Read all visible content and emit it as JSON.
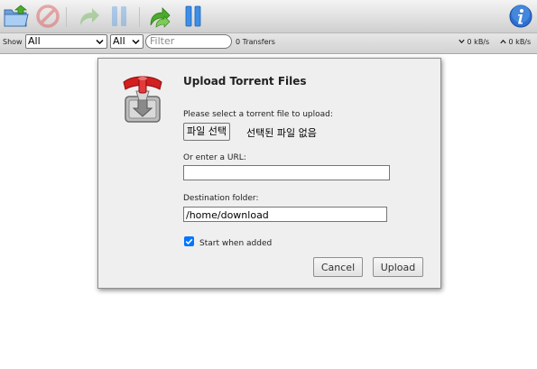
{
  "toolbar": {
    "buttons": [
      {
        "icon": "open-folder-icon"
      },
      {
        "icon": "remove-icon"
      },
      {
        "icon": "resume-icon"
      },
      {
        "icon": "pause-icon"
      },
      {
        "icon": "resume-all-icon"
      },
      {
        "icon": "pause-all-icon"
      },
      {
        "icon": "info-icon"
      }
    ]
  },
  "filterbar": {
    "show_label": "Show",
    "state_filter": "All",
    "tracker_filter": "All",
    "filter_placeholder": "Filter",
    "transfers": "0 Transfers",
    "download_speed": "0 kB/s",
    "upload_speed": "0 kB/s"
  },
  "dialog": {
    "title": "Upload Torrent Files",
    "file_label": "Please select a torrent file to upload:",
    "file_button": "파일 선택",
    "file_none": "선택된 파일 없음",
    "url_label": "Or enter a URL:",
    "url_value": "",
    "dest_label": "Destination folder:",
    "dest_value": "/home/download",
    "start_label": "Start when added",
    "start_checked": true,
    "cancel_label": "Cancel",
    "upload_label": "Upload"
  },
  "colors": {
    "accent_blue": "#0075ff",
    "resume_green": "#4caa2c",
    "pause_blue": "#3c8ee6",
    "remove_red": "#e05050"
  }
}
